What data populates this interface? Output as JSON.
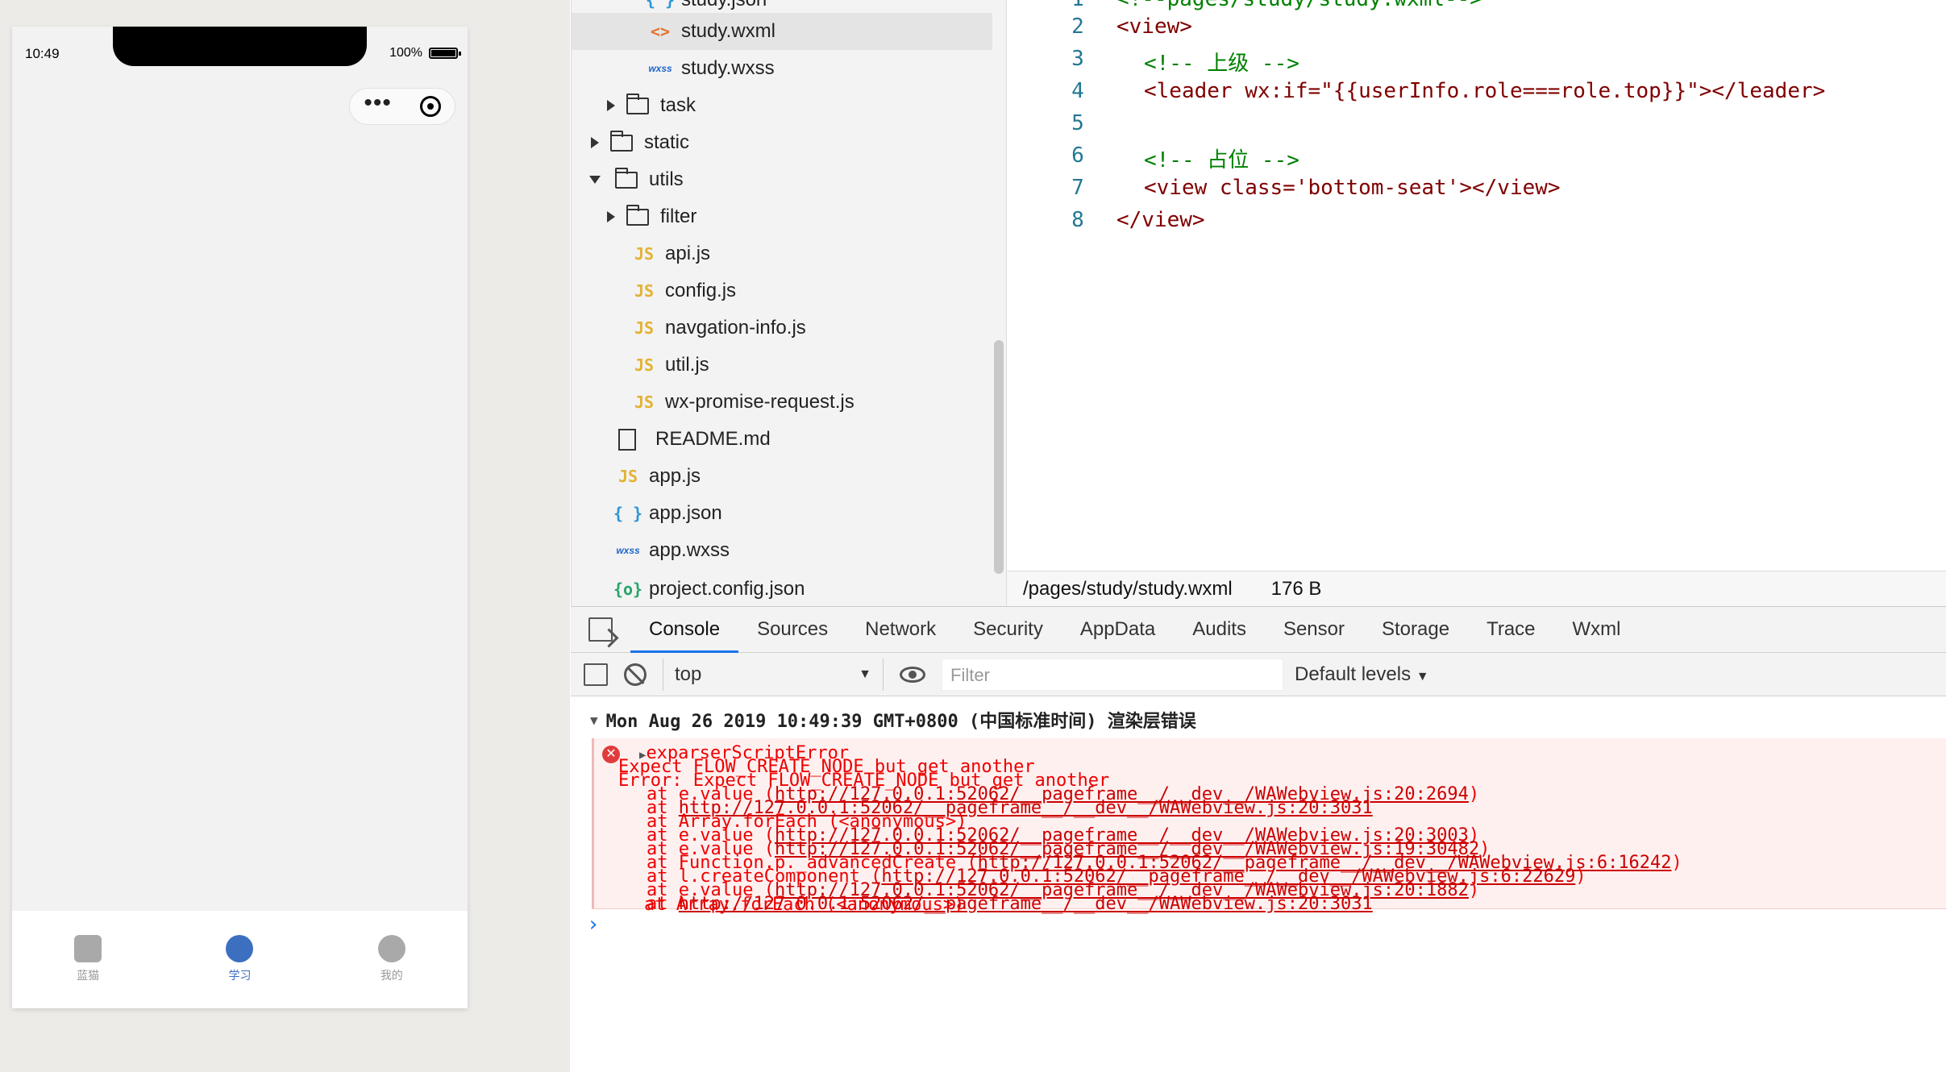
{
  "simulator": {
    "time": "10:49",
    "battery": "100%",
    "tabs": [
      {
        "label": "蓝猫",
        "icon": "tv-icon"
      },
      {
        "label": "学习",
        "icon": "compass-icon"
      },
      {
        "label": "我的",
        "icon": "profile-icon"
      }
    ],
    "active_tab": 1
  },
  "file_tree": {
    "items": [
      {
        "label": "study.json",
        "type": "json"
      },
      {
        "label": "study.wxml",
        "type": "wxml"
      },
      {
        "label": "study.wxss",
        "type": "wxss"
      },
      {
        "label": "task",
        "type": "folder"
      },
      {
        "label": "static",
        "type": "folder"
      },
      {
        "label": "utils",
        "type": "folder-open"
      },
      {
        "label": "filter",
        "type": "folder"
      },
      {
        "label": "api.js",
        "type": "js"
      },
      {
        "label": "config.js",
        "type": "js"
      },
      {
        "label": "navgation-info.js",
        "type": "js"
      },
      {
        "label": "util.js",
        "type": "js"
      },
      {
        "label": "wx-promise-request.js",
        "type": "js"
      },
      {
        "label": "README.md",
        "type": "doc"
      },
      {
        "label": "app.js",
        "type": "js"
      },
      {
        "label": "app.json",
        "type": "json"
      },
      {
        "label": "app.wxss",
        "type": "wxss"
      },
      {
        "label": "project.config.json",
        "type": "config"
      }
    ],
    "selected": "study.wxml"
  },
  "editor": {
    "lines": [
      {
        "no": "1",
        "text": "<!--pages/study/study.wxml-->"
      },
      {
        "no": "2",
        "text": "<view>"
      },
      {
        "no": "3",
        "text": "<!-- 上级 -->"
      },
      {
        "no": "4",
        "text": "<leader wx:if=\"{{userInfo.role===role.top}}\"></leader>"
      },
      {
        "no": "5",
        "text": ""
      },
      {
        "no": "6",
        "text": "<!-- 占位 -->"
      },
      {
        "no": "7",
        "text": "<view class='bottom-seat'></view>"
      },
      {
        "no": "8",
        "text": "</view>"
      }
    ],
    "file_path": "/pages/study/study.wxml",
    "file_size": "176 B"
  },
  "devtools": {
    "tabs": [
      "Console",
      "Sources",
      "Network",
      "Security",
      "AppData",
      "Audits",
      "Sensor",
      "Storage",
      "Trace",
      "Wxml"
    ],
    "active_tab": "Console",
    "context": "top",
    "filter_placeholder": "Filter",
    "levels": "Default levels"
  },
  "console": {
    "group_header": "Mon Aug 26 2019 10:49:39 GMT+0800 (中国标准时间) 渲染层错误",
    "error_title": "exparserScriptError",
    "messages": [
      "Expect FLOW_CREATE_NODE but get another",
      "Error: Expect FLOW_CREATE_NODE but get another"
    ],
    "stack": [
      {
        "prefix": "at e.value (",
        "url": "http://127.0.0.1:52062/__pageframe__/__dev__/WAWebview.js:20:2694",
        "suffix": ")"
      },
      {
        "prefix": "at ",
        "url": "http://127.0.0.1:52062/__pageframe__/__dev__/WAWebview.js:20:3031",
        "suffix": ""
      },
      {
        "prefix": "at Array.forEach (<anonymous>)",
        "url": "",
        "suffix": ""
      },
      {
        "prefix": "at e.value (",
        "url": "http://127.0.0.1:52062/__pageframe__/__dev__/WAWebview.js:20:3003",
        "suffix": ")"
      },
      {
        "prefix": "at e.value (",
        "url": "http://127.0.0.1:52062/__pageframe__/__dev__/WAWebview.js:19:30482",
        "suffix": ")"
      },
      {
        "prefix": "at Function.p._advancedCreate (",
        "url": "http://127.0.0.1:52062/__pageframe__/__dev__/WAWebview.js:6:16242",
        "suffix": ")"
      },
      {
        "prefix": "at l.createComponent (",
        "url": "http://127.0.0.1:52062/__pageframe__/__dev__/WAWebview.js:6:22629",
        "suffix": ")"
      },
      {
        "prefix": "at e.value (",
        "url": "http://127.0.0.1:52062/__pageframe__/__dev__/WAWebview.js:20:1882",
        "suffix": ")"
      },
      {
        "prefix": "at ",
        "url": "http://127.0.0.1:52062/__pageframe__/__dev__/WAWebview.js:20:3031",
        "suffix": ""
      },
      {
        "prefix": "at Array.forEach (<anonymous>)",
        "url": "",
        "suffix": ""
      }
    ]
  }
}
